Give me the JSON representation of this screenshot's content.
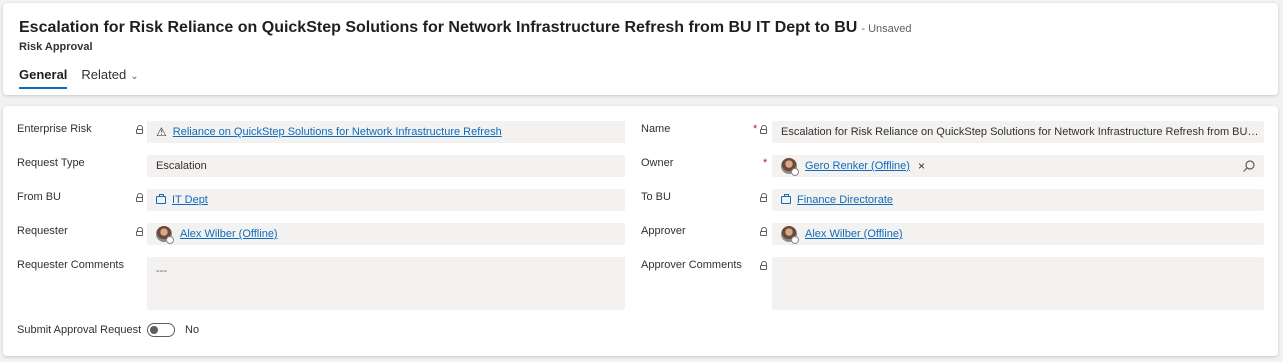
{
  "header": {
    "title": "Escalation for Risk Reliance on QuickStep Solutions for Network Infrastructure Refresh from BU IT Dept to BU",
    "unsaved": "- Unsaved",
    "entity": "Risk Approval",
    "tabs": [
      {
        "label": "General",
        "active": true
      },
      {
        "label": "Related",
        "active": false,
        "icon": "chevron-down-icon"
      }
    ]
  },
  "form": {
    "left": {
      "enterprise_risk": {
        "label": "Enterprise Risk",
        "value": "Reliance on QuickStep Solutions for Network Infrastructure Refresh",
        "icon": "warning-icon"
      },
      "request_type": {
        "label": "Request Type",
        "value": "Escalation"
      },
      "from_bu": {
        "label": "From BU",
        "value": "IT Dept",
        "icon": "business-unit-icon"
      },
      "requester": {
        "label": "Requester",
        "value": "Alex Wilber (Offline)"
      },
      "requester_comments": {
        "label": "Requester Comments",
        "value": "---"
      },
      "submit_approval": {
        "label": "Submit Approval Request",
        "value": "No",
        "checked": false
      }
    },
    "right": {
      "name": {
        "label": "Name",
        "required": "*",
        "value": "Escalation for Risk Reliance on QuickStep Solutions for Network Infrastructure Refresh from BU IT Dept to ..."
      },
      "owner": {
        "label": "Owner",
        "required": "*",
        "value": "Gero Renker (Offline)",
        "remove": "×"
      },
      "to_bu": {
        "label": "To BU",
        "value": "Finance Directorate",
        "icon": "business-unit-icon"
      },
      "approver": {
        "label": "Approver",
        "value": "Alex Wilber (Offline)"
      },
      "approver_comments": {
        "label": "Approver Comments",
        "value": ""
      }
    }
  },
  "colors": {
    "link": "#0f6cbd",
    "required": "#a4262c",
    "field_bg": "#f3f2f1",
    "accent": "#0f6cbd"
  }
}
